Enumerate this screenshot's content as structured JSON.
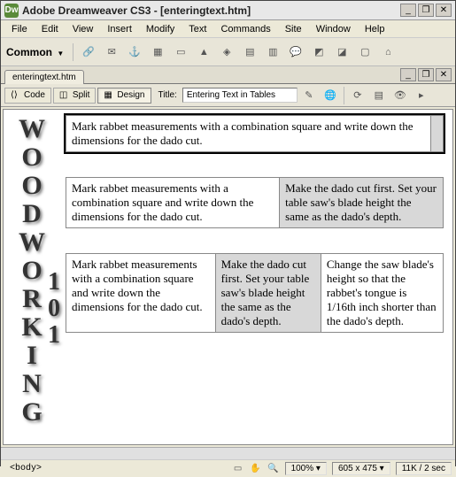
{
  "window": {
    "title": "Adobe Dreamweaver CS3 - [enteringtext.htm]",
    "min_icon": "_",
    "max_icon": "❐",
    "close_icon": "✕"
  },
  "menu": {
    "file": "File",
    "edit": "Edit",
    "view": "View",
    "insert": "Insert",
    "modify": "Modify",
    "text": "Text",
    "commands": "Commands",
    "site": "Site",
    "window": "Window",
    "help": "Help"
  },
  "insert_bar": {
    "category": "Common",
    "caret": "▼"
  },
  "doc": {
    "tab_name": "enteringtext.htm",
    "view_code": "Code",
    "view_split": "Split",
    "view_design": "Design",
    "title_label": "Title:",
    "title_value": "Entering Text in Tables"
  },
  "page": {
    "heading_letters": [
      "W",
      "O",
      "O",
      "D",
      "W",
      "O",
      "R",
      "K",
      "I",
      "N",
      "G"
    ],
    "sub_letters": [
      "1",
      "0",
      "1"
    ],
    "table1": {
      "c1": "Mark rabbet measurements with a combination square and write down the dimensions for the dado cut."
    },
    "table2": {
      "c1": "Mark rabbet measurements with a combination square and write down the dimensions for the dado cut.",
      "c2": "Make the dado cut first. Set your table saw's blade height the same as the dado's depth."
    },
    "table3": {
      "c1": "Mark rabbet measurements with a combination square and write down the dimensions for the dado cut.",
      "c2": "Make the dado cut first. Set your table saw's blade height the same as the dado's depth.",
      "c3": "Change the saw blade's height so that the rabbet's tongue is 1/16th inch shorter than the dado's depth."
    }
  },
  "status": {
    "tag": "<body>",
    "zoom": "100%",
    "dims": "605 x 475",
    "size": "11K / 2 sec"
  }
}
